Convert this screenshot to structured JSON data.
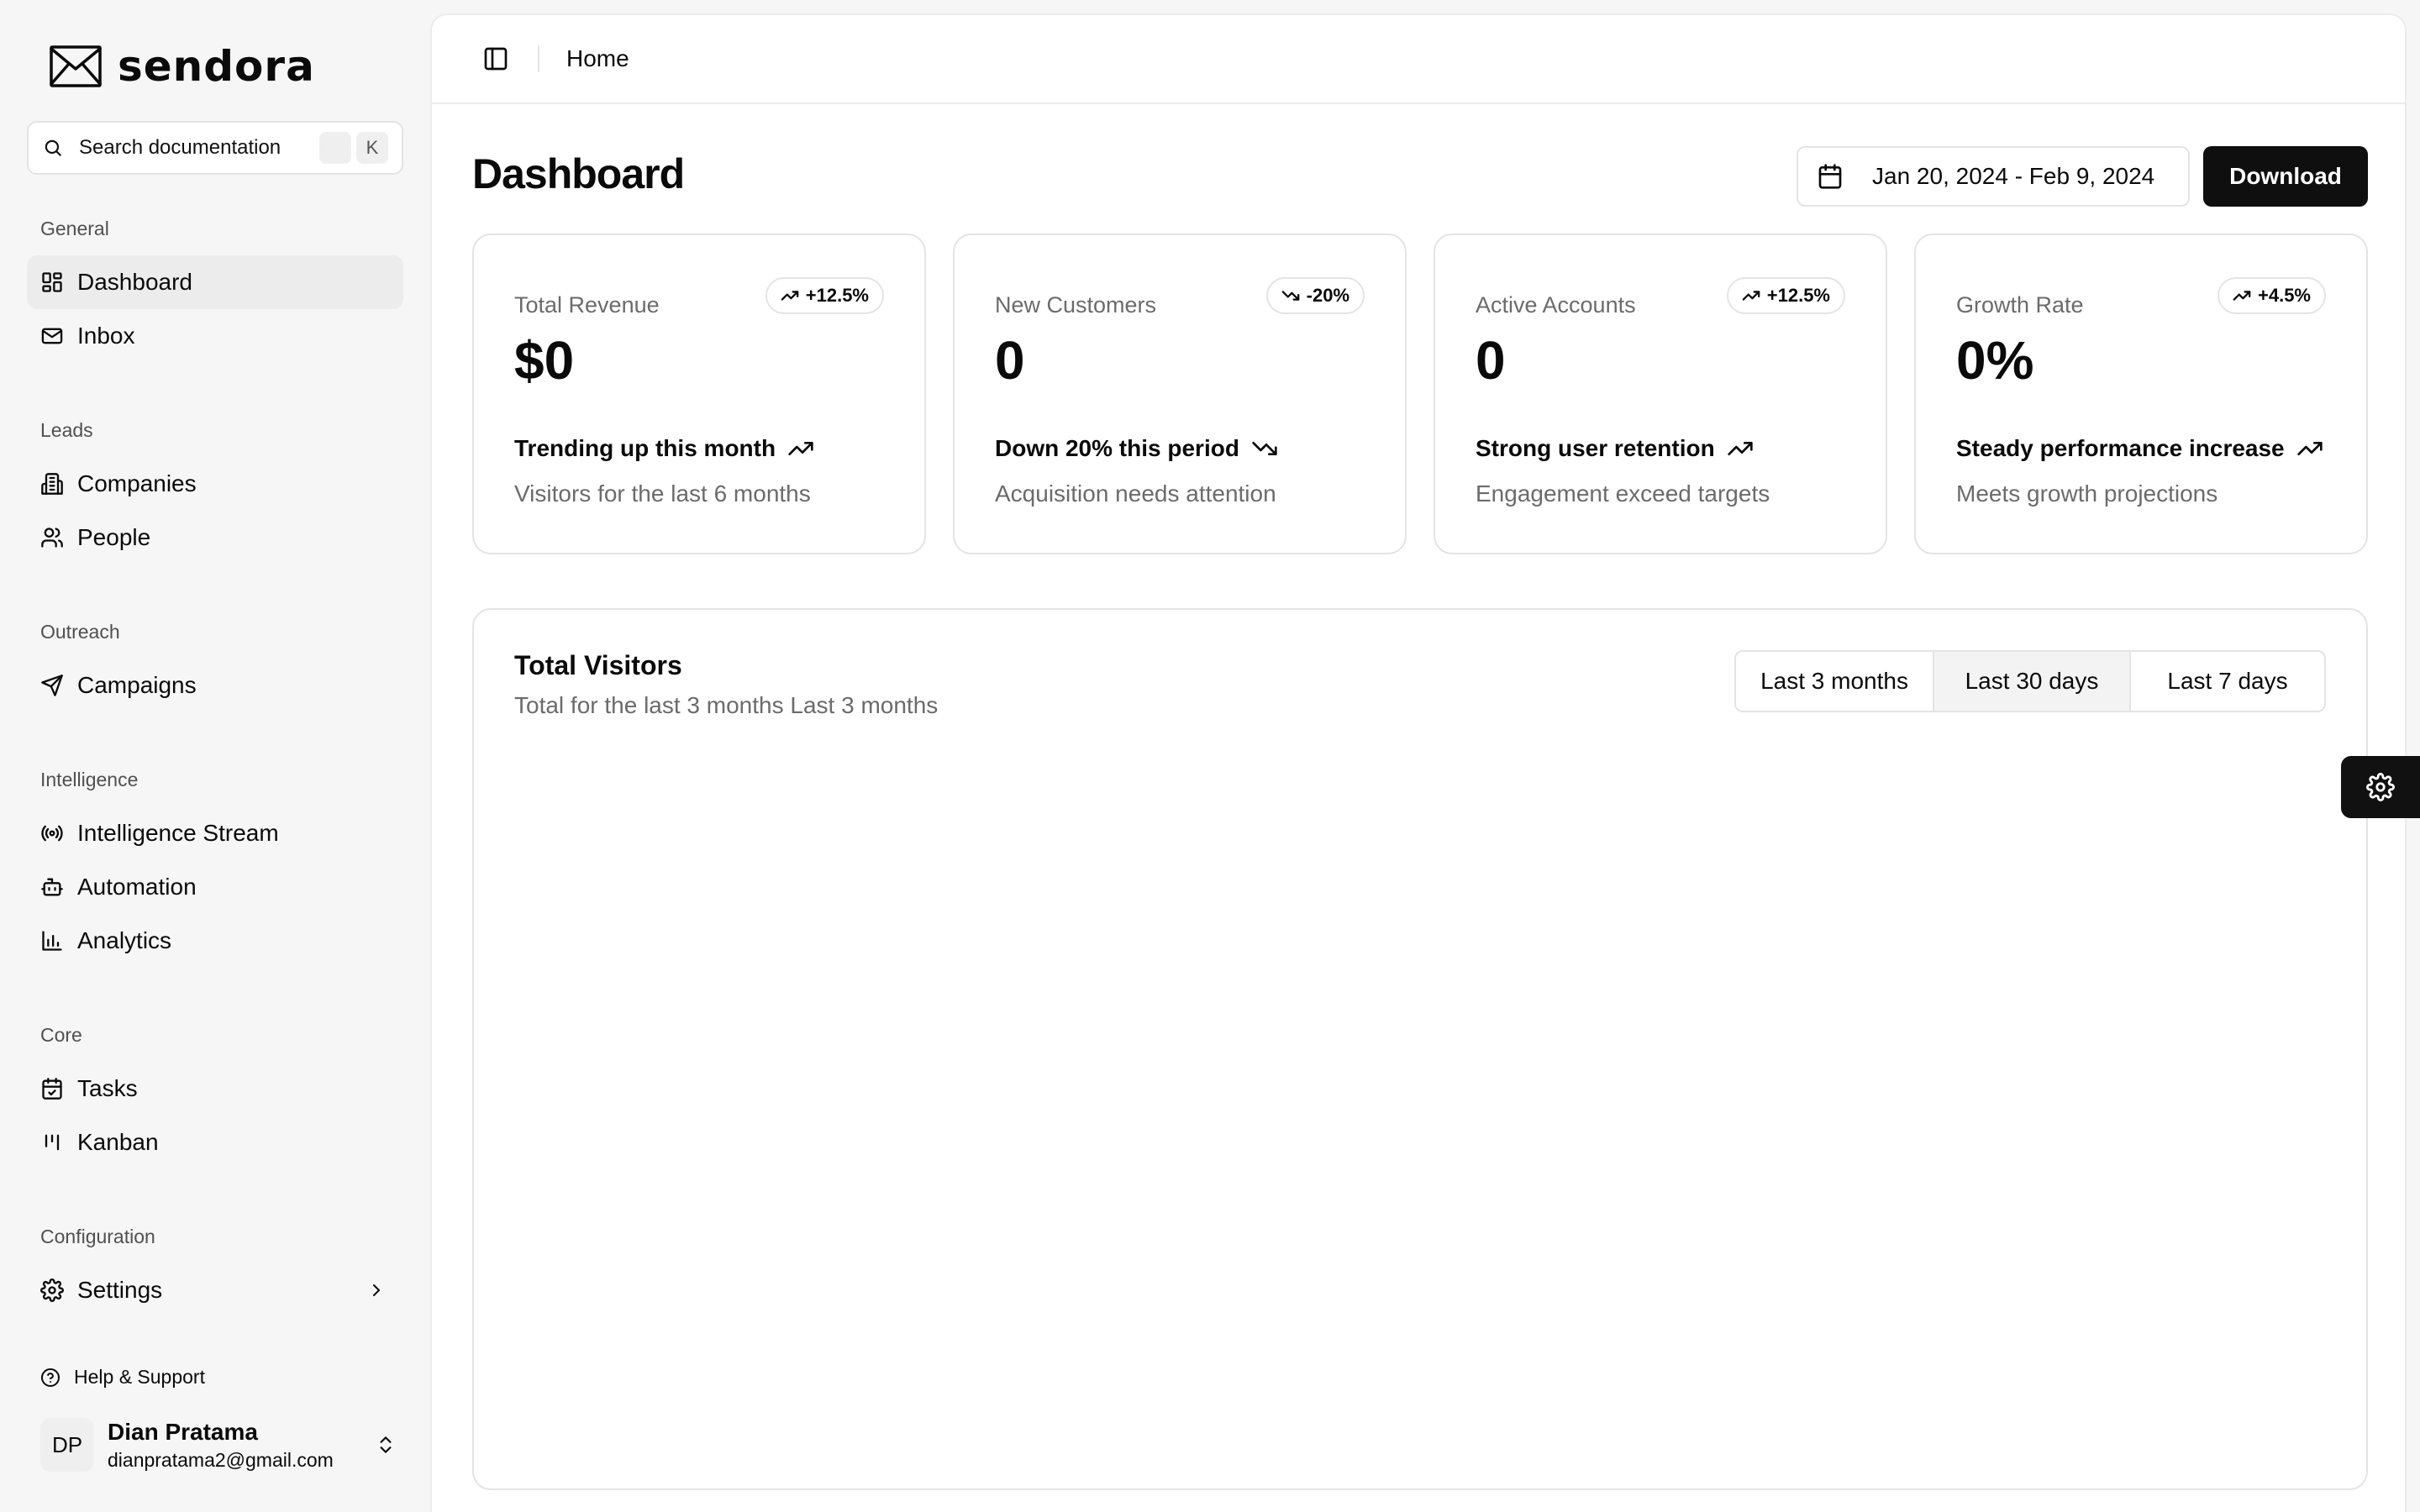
{
  "brand": {
    "name": "sendora"
  },
  "search": {
    "placeholder": "Search documentation",
    "shortcut_key": "K"
  },
  "sidebar": {
    "groups": [
      {
        "label": "General",
        "items": [
          {
            "label": "Dashboard",
            "icon": "grid-icon",
            "active": true
          },
          {
            "label": "Inbox",
            "icon": "mail-icon"
          }
        ]
      },
      {
        "label": "Leads",
        "items": [
          {
            "label": "Companies",
            "icon": "building-icon"
          },
          {
            "label": "People",
            "icon": "users-icon"
          }
        ]
      },
      {
        "label": "Outreach",
        "items": [
          {
            "label": "Campaigns",
            "icon": "send-icon"
          }
        ]
      },
      {
        "label": "Intelligence",
        "items": [
          {
            "label": "Intelligence Stream",
            "icon": "radio-icon"
          },
          {
            "label": "Automation",
            "icon": "bot-icon"
          },
          {
            "label": "Analytics",
            "icon": "bar-chart-icon"
          }
        ]
      },
      {
        "label": "Core",
        "items": [
          {
            "label": "Tasks",
            "icon": "calendar-check-icon"
          },
          {
            "label": "Kanban",
            "icon": "kanban-icon"
          }
        ]
      },
      {
        "label": "Configuration",
        "items": [
          {
            "label": "Settings",
            "icon": "gear-icon"
          }
        ]
      }
    ],
    "help": "Help & Support",
    "user": {
      "initials": "DP",
      "name": "Dian Pratama",
      "email": "dianpratama2@gmail.com"
    }
  },
  "topbar": {
    "breadcrumb": "Home"
  },
  "page": {
    "title": "Dashboard",
    "date_range": "Jan 20, 2024 - Feb 9, 2024",
    "download": "Download"
  },
  "cards": [
    {
      "label": "Total Revenue",
      "badge": "+12.5%",
      "direction": "up",
      "value": "$0",
      "trend": "Trending up this month",
      "sub": "Visitors for the last 6 months"
    },
    {
      "label": "New Customers",
      "badge": "-20%",
      "direction": "down",
      "value": "0",
      "trend": "Down 20% this period",
      "sub": "Acquisition needs attention"
    },
    {
      "label": "Active Accounts",
      "badge": "+12.5%",
      "direction": "up",
      "value": "0",
      "trend": "Strong user retention",
      "sub": "Engagement exceed targets"
    },
    {
      "label": "Growth Rate",
      "badge": "+4.5%",
      "direction": "up",
      "value": "0%",
      "trend": "Steady performance increase",
      "sub": "Meets growth projections"
    }
  ],
  "visitors": {
    "title": "Total Visitors",
    "subtitle": "Total for the last 3 months Last 3 months",
    "ranges": [
      {
        "label": "Last 3 months",
        "active": false
      },
      {
        "label": "Last 30 days",
        "active": true
      },
      {
        "label": "Last 7 days",
        "active": false
      }
    ]
  }
}
